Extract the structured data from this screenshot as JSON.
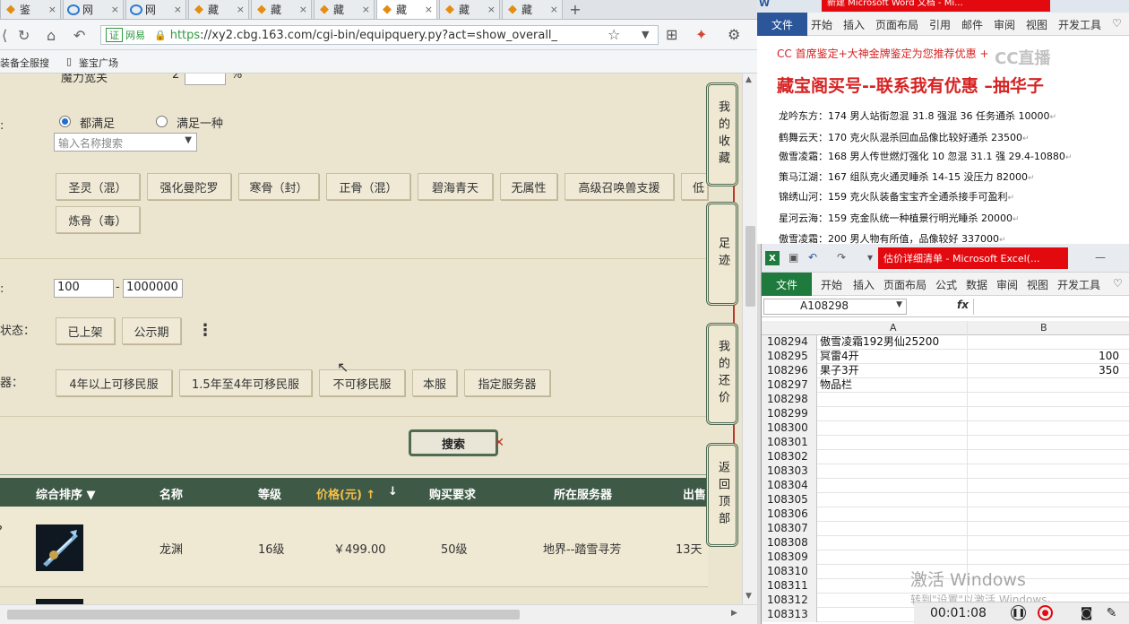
{
  "browser": {
    "tabs": [
      {
        "label": "鉴",
        "icon": "cbg",
        "active": false
      },
      {
        "label": "网",
        "icon": "ie",
        "active": false
      },
      {
        "label": "网",
        "icon": "ie",
        "active": false
      },
      {
        "label": "藏",
        "icon": "cbg",
        "active": false
      },
      {
        "label": "藏",
        "icon": "cbg",
        "active": false
      },
      {
        "label": "藏",
        "icon": "cbg",
        "active": false
      },
      {
        "label": "藏",
        "icon": "cbg",
        "active": true
      },
      {
        "label": "藏",
        "icon": "cbg",
        "active": false
      },
      {
        "label": "藏",
        "icon": "cbg",
        "active": false
      }
    ],
    "close_glyph": "×",
    "new_tab_glyph": "+",
    "address": {
      "cert_label": "证",
      "cert_name": "网易",
      "url_https": "https",
      "url_rest": "://xy2.cbg.163.com/cgi-bin/equipquery.py?act=show_overall_"
    },
    "bookmarks": [
      "装备全服搜",
      "鉴宝广场"
    ]
  },
  "page": {
    "top_partial_label": "魔力宽关",
    "top_partial_value": "2",
    "top_partial_unit": "%",
    "match_label": ":",
    "radio_all": "都满足",
    "radio_any": "满足一种",
    "name_search_placeholder": "输入名称搜索",
    "skills": [
      "圣灵（混）",
      "强化曼陀罗",
      "寒骨（封）",
      "正骨（混）",
      "碧海青天",
      "无属性",
      "高级召唤兽支援",
      "低",
      "炼骨（毒）"
    ],
    "price_label": ":",
    "price_min": "100",
    "price_sep": "-",
    "price_max": "1000000",
    "status_label": "状态：",
    "status_options": [
      "已上架",
      "公示期"
    ],
    "more_glyph": "⋮",
    "server_label": "器：",
    "server_options": [
      "4年以上可移民服",
      "1.5年至4年可移民服",
      "不可移民服",
      "本服",
      "指定服务器"
    ],
    "search_button": "搜索",
    "table_headers": {
      "sort": "综合排序 ▼",
      "name": "名称",
      "level": "等级",
      "price": "价格(元) ↑",
      "price_down": "↓",
      "requirement": "购买要求",
      "server": "所在服务器",
      "sale": "出售"
    },
    "rows": [
      {
        "name": "龙渊",
        "level": "16级",
        "price": "￥499.00",
        "requirement": "50级",
        "server": "地界--踏雪寻芳",
        "time": "13天"
      }
    ],
    "side_panels": [
      "我的收藏",
      "足迹",
      "我的还价",
      "返回顶部"
    ]
  },
  "word": {
    "title": "新建 Microsoft Word 文档 - Mi...",
    "tabs": [
      "文件",
      "开始",
      "插入",
      "页面布局",
      "引用",
      "邮件",
      "审阅",
      "视图",
      "开发工具"
    ],
    "line1": "CC 首席鉴定+大神金牌鉴定为您推荐优惠 +",
    "line2": "藏宝阁买号--联系我有优惠 –抽华子",
    "lines": [
      "龙吟东方：174 男人站街忽混 31.8 强混 36 任务通杀 10000",
      "鹤舞云天：170 克火队混杀回血品像比较好通杀 23500",
      "傲雪凌霜：168 男人传世燃灯强化 10 忽混 31.1 强 29.4-10880",
      "策马江湖：167 组队克火通灵睡杀 14-15 没压力 82000",
      "锦绣山河：159 克火队装备宝宝齐全通杀接手可盈利",
      "星河云海：159 克金队统一种植景行明光睡杀 20000",
      "傲雪凌霜：200 男人物有所值，品像较好 337000"
    ],
    "para_mark": "↵",
    "watermark": "CC直播"
  },
  "excel": {
    "title": "估价详细清单 - Microsoft Excel(...",
    "tabs": [
      "文件",
      "开始",
      "插入",
      "页面布局",
      "公式",
      "数据",
      "审阅",
      "视图",
      "开发工具"
    ],
    "cell_ref": "A108298",
    "fx": "fx",
    "columns": [
      "A",
      "B"
    ],
    "rows": [
      {
        "n": "108294",
        "a": "傲雪凌霜192男仙25200",
        "b": ""
      },
      {
        "n": "108295",
        "a": "冥雷4开",
        "b": "100"
      },
      {
        "n": "108296",
        "a": "果子3开",
        "b": "350"
      },
      {
        "n": "108297",
        "a": "物品栏",
        "b": ""
      },
      {
        "n": "108298",
        "a": "",
        "b": ""
      },
      {
        "n": "108299",
        "a": "",
        "b": ""
      },
      {
        "n": "108300",
        "a": "",
        "b": ""
      },
      {
        "n": "108301",
        "a": "",
        "b": ""
      },
      {
        "n": "108302",
        "a": "",
        "b": ""
      },
      {
        "n": "108303",
        "a": "",
        "b": ""
      },
      {
        "n": "108304",
        "a": "",
        "b": ""
      },
      {
        "n": "108305",
        "a": "",
        "b": ""
      },
      {
        "n": "108306",
        "a": "",
        "b": ""
      },
      {
        "n": "108307",
        "a": "",
        "b": ""
      },
      {
        "n": "108308",
        "a": "",
        "b": ""
      },
      {
        "n": "108309",
        "a": "",
        "b": ""
      },
      {
        "n": "108310",
        "a": "",
        "b": ""
      },
      {
        "n": "108311",
        "a": "",
        "b": ""
      },
      {
        "n": "108312",
        "a": "",
        "b": ""
      },
      {
        "n": "108313",
        "a": "",
        "b": ""
      }
    ]
  },
  "overlay": {
    "activate_title": "激活 Windows",
    "activate_sub": "转到\"设置\"以激活 Windows。",
    "rec_time": "00:01:08"
  }
}
